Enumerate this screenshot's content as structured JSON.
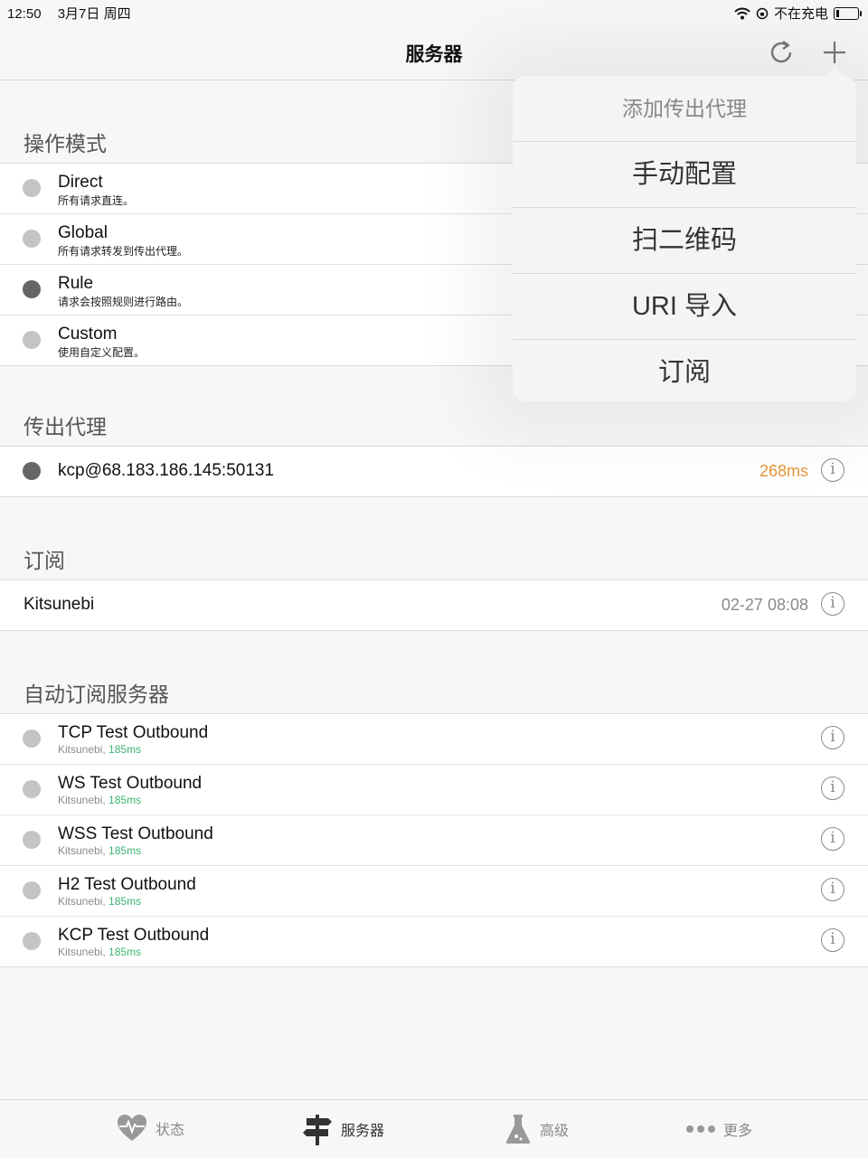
{
  "status_bar": {
    "time": "12:50",
    "date": "3月7日 周四",
    "charging": "不在充电"
  },
  "nav": {
    "title": "服务器",
    "refresh_icon": "refresh-icon",
    "add_icon": "plus-icon"
  },
  "modes": {
    "header": "操作模式",
    "items": [
      {
        "name": "Direct",
        "desc": "所有请求直连。",
        "active": false
      },
      {
        "name": "Global",
        "desc": "所有请求转发到传出代理。",
        "active": false
      },
      {
        "name": "Rule",
        "desc": "请求会按照规则进行路由。",
        "active": true
      },
      {
        "name": "Custom",
        "desc": "使用自定义配置。",
        "active": false
      }
    ]
  },
  "outbound": {
    "header": "传出代理",
    "item": {
      "name": "kcp@68.183.186.145:50131",
      "latency": "268ms"
    }
  },
  "subscription": {
    "header": "订阅",
    "item": {
      "name": "Kitsunebi",
      "time": "02-27 08:08"
    }
  },
  "auto_servers": {
    "header": "自动订阅服务器",
    "items": [
      {
        "name": "TCP Test Outbound",
        "source": "Kitsunebi, ",
        "latency": "185ms"
      },
      {
        "name": "WS Test Outbound",
        "source": "Kitsunebi, ",
        "latency": "185ms"
      },
      {
        "name": "WSS Test Outbound",
        "source": "Kitsunebi, ",
        "latency": "185ms"
      },
      {
        "name": "H2 Test Outbound",
        "source": "Kitsunebi, ",
        "latency": "185ms"
      },
      {
        "name": "KCP Test Outbound",
        "source": "Kitsunebi, ",
        "latency": "185ms"
      }
    ]
  },
  "popover": {
    "title": "添加传出代理",
    "options": [
      "手动配置",
      "扫二维码",
      "URI 导入",
      "订阅"
    ]
  },
  "tabs": [
    {
      "label": "状态",
      "icon": "heart-pulse-icon"
    },
    {
      "label": "服务器",
      "icon": "signpost-icon"
    },
    {
      "label": "高级",
      "icon": "flask-icon"
    },
    {
      "label": "更多",
      "icon": "more-dots-icon"
    }
  ],
  "colors": {
    "latency_orange": "#e8973a",
    "latency_green": "#3cb371",
    "active_dot": "#666666",
    "inactive_dot": "#c4c4c4"
  }
}
